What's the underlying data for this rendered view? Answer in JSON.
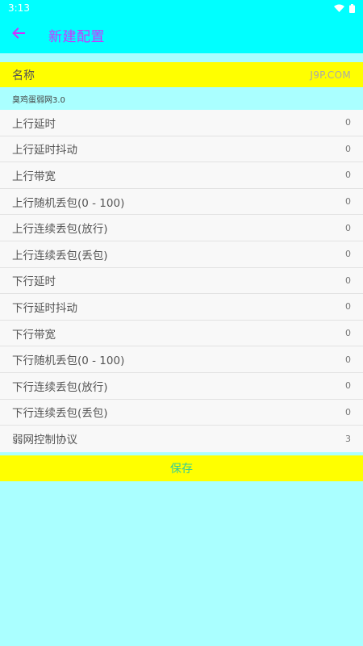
{
  "status_bar": {
    "time": "3:13"
  },
  "app_bar": {
    "title": "新建配置"
  },
  "name_row": {
    "label": "名称",
    "value": "J9P.COM"
  },
  "subtitle": "臭鸡蛋弱网3.0",
  "settings": [
    {
      "label": "上行延时",
      "value": "0"
    },
    {
      "label": "上行延时抖动",
      "value": "0"
    },
    {
      "label": "上行带宽",
      "value": "0"
    },
    {
      "label": "上行随机丢包(0 - 100)",
      "value": "0"
    },
    {
      "label": "上行连续丢包(放行)",
      "value": "0"
    },
    {
      "label": "上行连续丢包(丢包)",
      "value": "0"
    },
    {
      "label": "下行延时",
      "value": "0"
    },
    {
      "label": "下行延时抖动",
      "value": "0"
    },
    {
      "label": "下行带宽",
      "value": "0"
    },
    {
      "label": "下行随机丢包(0 - 100)",
      "value": "0"
    },
    {
      "label": "下行连续丢包(放行)",
      "value": "0"
    },
    {
      "label": "下行连续丢包(丢包)",
      "value": "0"
    },
    {
      "label": "弱网控制协议",
      "value": "3"
    }
  ],
  "save_label": "保存",
  "colors": {
    "app_bar": "#00ffff",
    "title": "#cc33ff",
    "highlight_row": "#ffff00",
    "background": "#aaffff",
    "save_text": "#33cc99"
  },
  "icons": [
    "back-arrow-icon",
    "wifi-icon",
    "battery-icon"
  ]
}
